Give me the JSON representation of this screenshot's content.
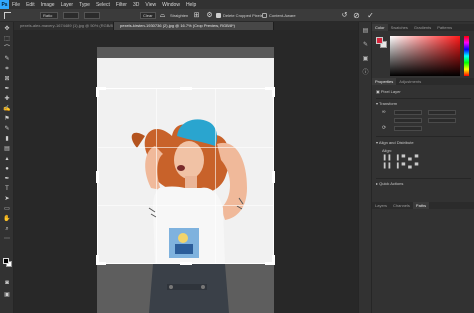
{
  "app": {
    "logo": "Ps"
  },
  "menu": [
    "File",
    "Edit",
    "Image",
    "Layer",
    "Type",
    "Select",
    "Filter",
    "3D",
    "View",
    "Window",
    "Help"
  ],
  "options_bar": {
    "ratio_value": "Ratio",
    "clear_label": "Clear",
    "straighten_label": "Straighten",
    "delete_cropped_label": "Delete Cropped Pixels",
    "content_aware_label": "Content-Aware",
    "icons": [
      "crop-tool-icon",
      "grid-icon",
      "gear-icon",
      "undo-icon",
      "cancel-icon",
      "commit-icon"
    ]
  },
  "tabs": [
    {
      "label": "pexels-alex-mavery-1674489 (1).jpg @ 50% (RGB/8*)",
      "active": false
    },
    {
      "label": "pexels-kirsten-1930736 (2).jpg @ 16.7% (Crop Preview, RGB/8*)",
      "active": true
    }
  ],
  "panels": {
    "color_tabs": [
      "Color",
      "Swatches",
      "Gradients",
      "Patterns"
    ],
    "properties_tabs": [
      "Properties",
      "Adjustments"
    ],
    "layer_type": "Pixel Layer",
    "transform_label": "Transform",
    "align_label": "Align and Distribute",
    "align_sub": "Align:",
    "quick_actions_label": "Quick Actions",
    "bottom_tabs": [
      "Layers",
      "Channels",
      "Paths"
    ]
  },
  "colors": {
    "accent": "#31a8ff",
    "foreground": "#000000",
    "background": "#ffffff",
    "hat": "#2aa5cf",
    "hair": "#c8622a"
  }
}
